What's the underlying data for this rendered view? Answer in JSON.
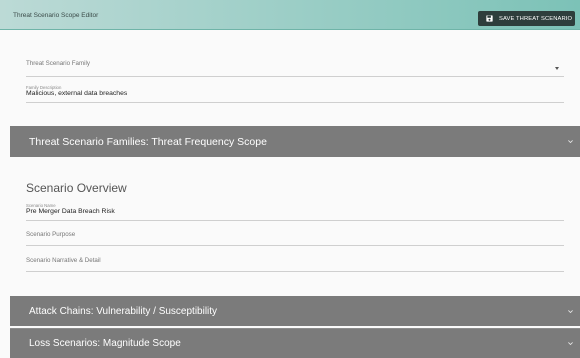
{
  "header": {
    "title": "Threat Scenario Scope Editor",
    "save_label": "SAVE THREAT SCENARIO"
  },
  "family": {
    "field_label": "Threat Scenario Family",
    "field_value": "",
    "description_label": "Family Description",
    "description_value": "Malicious, external data breaches"
  },
  "accordions": {
    "frequency": "Threat Scenario Families: Threat Frequency Scope",
    "attack": "Attack Chains: Vulnerability / Susceptibility",
    "loss": "Loss Scenarios: Magnitude Scope"
  },
  "overview": {
    "heading": "Scenario Overview",
    "name_label": "Scenario Name",
    "name_value": "Pre Merger Data Breach Risk",
    "purpose_label": "Scenario Purpose",
    "narrative_label": "Scenario Narrative & Detail"
  },
  "colors": {
    "header_teal": "#7cc2b7",
    "button_dark": "#2e3e3c",
    "accordion_gray": "#7b7b7b"
  }
}
